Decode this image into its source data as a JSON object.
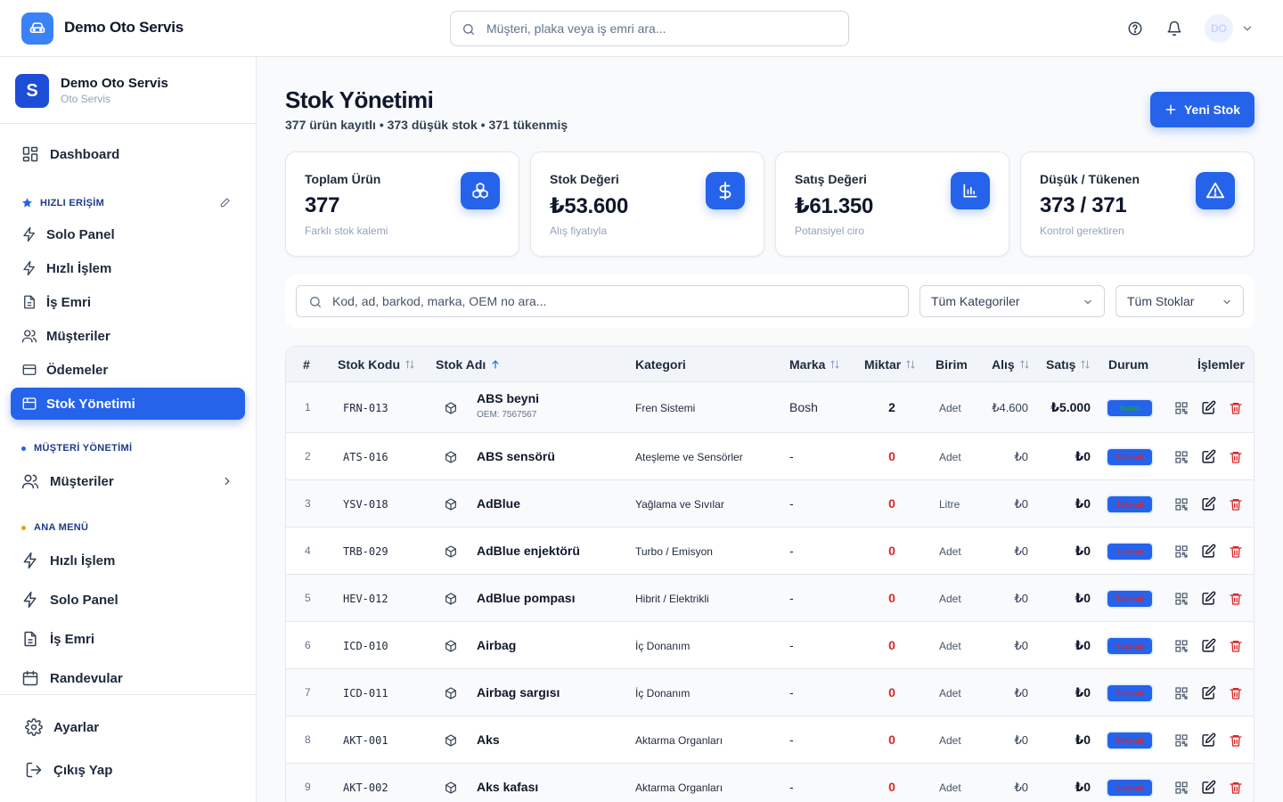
{
  "app": {
    "brand": "Demo Oto Servis",
    "search_placeholder": "Müşteri, plaka veya iş emri ara...",
    "avatar_initials": "DO"
  },
  "sidebar": {
    "org_initial": "S",
    "org_name": "Demo Oto Servis",
    "org_type": "Oto Servis",
    "dashboard": "Dashboard",
    "quick_access_title": "HIZLI ERİŞİM",
    "quick_items": [
      {
        "label": "Solo Panel",
        "icon": "bolt-icon"
      },
      {
        "label": "Hızlı İşlem",
        "icon": "bolt-icon"
      },
      {
        "label": "İş Emri",
        "icon": "document-icon"
      },
      {
        "label": "Müşteriler",
        "icon": "users-icon"
      },
      {
        "label": "Ödemeler",
        "icon": "credit-card-icon"
      },
      {
        "label": "Stok Yönetimi",
        "icon": "package-icon",
        "active": true
      }
    ],
    "customer_mgmt_title": "MÜŞTERİ YÖNETİMİ",
    "customer_mgmt_item": "Müşteriler",
    "main_menu_title": "ANA MENÜ",
    "main_items": [
      {
        "label": "Hızlı İşlem",
        "icon": "bolt-icon"
      },
      {
        "label": "Solo Panel",
        "icon": "bolt-icon"
      },
      {
        "label": "İş Emri",
        "icon": "document-icon"
      },
      {
        "label": "Randevular",
        "icon": "calendar-icon"
      }
    ],
    "settings": "Ayarlar",
    "logout": "Çıkış Yap",
    "colors": {
      "accent": "#2563eb",
      "quick_dot": "#2563eb",
      "mgmt_dot": "#2563eb",
      "main_dot": "#f59e0b"
    }
  },
  "page": {
    "title": "Stok Yönetimi",
    "subtitle": "377 ürün kayıtlı • 373 düşük stok • 371 tükenmiş",
    "new_button": "Yeni Stok"
  },
  "stats": [
    {
      "label": "Toplam Ürün",
      "value": "377",
      "hint": "Farklı stok kalemi",
      "icon": "cubes-icon"
    },
    {
      "label": "Stok Değeri",
      "value": "₺53.600",
      "hint": "Alış fiyatıyla",
      "icon": "dollar-icon"
    },
    {
      "label": "Satış Değeri",
      "value": "₺61.350",
      "hint": "Potansiyel ciro",
      "icon": "bar-chart-icon"
    },
    {
      "label": "Düşük / Tükenen",
      "value": "373 / 371",
      "hint": "Kontrol gerektiren",
      "icon": "warning-icon"
    }
  ],
  "filters": {
    "search_placeholder": "Kod, ad, barkod, marka, OEM no ara...",
    "category": "Tüm Kategoriler",
    "stock": "Tüm Stoklar"
  },
  "table": {
    "headers": {
      "num": "#",
      "code": "Stok Kodu",
      "name": "Stok Adı",
      "category": "Kategori",
      "brand": "Marka",
      "qty": "Miktar",
      "unit": "Birim",
      "buy": "Alış",
      "sell": "Satış",
      "status": "Durum",
      "actions": "İşlemler"
    },
    "rows": [
      {
        "num": "1",
        "code": "FRN-013",
        "name": "ABS beyni",
        "oem": "OEM: 7567567",
        "category": "Fren Sistemi",
        "brand": "Bosh",
        "qty": "2",
        "unit": "Adet",
        "buy": "₺4.600",
        "sell": "₺5.000",
        "status": "Yeterli",
        "status_type": "ok"
      },
      {
        "num": "2",
        "code": "ATS-016",
        "name": "ABS sensörü",
        "oem": "",
        "category": "Ateşleme ve Sensörler",
        "brand": "-",
        "qty": "0",
        "unit": "Adet",
        "buy": "₺0",
        "sell": "₺0",
        "status": "Tükendi",
        "status_type": "out"
      },
      {
        "num": "3",
        "code": "YSV-018",
        "name": "AdBlue",
        "oem": "",
        "category": "Yağlama ve Sıvılar",
        "brand": "-",
        "qty": "0",
        "unit": "Litre",
        "buy": "₺0",
        "sell": "₺0",
        "status": "Tükendi",
        "status_type": "out"
      },
      {
        "num": "4",
        "code": "TRB-029",
        "name": "AdBlue enjektörü",
        "oem": "",
        "category": "Turbo / Emisyon",
        "brand": "-",
        "qty": "0",
        "unit": "Adet",
        "buy": "₺0",
        "sell": "₺0",
        "status": "Tükendi",
        "status_type": "out"
      },
      {
        "num": "5",
        "code": "HEV-012",
        "name": "AdBlue pompası",
        "oem": "",
        "category": "Hibrit / Elektrikli",
        "brand": "-",
        "qty": "0",
        "unit": "Adet",
        "buy": "₺0",
        "sell": "₺0",
        "status": "Tükendi",
        "status_type": "out"
      },
      {
        "num": "6",
        "code": "ICD-010",
        "name": "Airbag",
        "oem": "",
        "category": "İç Donanım",
        "brand": "-",
        "qty": "0",
        "unit": "Adet",
        "buy": "₺0",
        "sell": "₺0",
        "status": "Tükendi",
        "status_type": "out"
      },
      {
        "num": "7",
        "code": "ICD-011",
        "name": "Airbag sargısı",
        "oem": "",
        "category": "İç Donanım",
        "brand": "-",
        "qty": "0",
        "unit": "Adet",
        "buy": "₺0",
        "sell": "₺0",
        "status": "Tükendi",
        "status_type": "out"
      },
      {
        "num": "8",
        "code": "AKT-001",
        "name": "Aks",
        "oem": "",
        "category": "Aktarma Organları",
        "brand": "-",
        "qty": "0",
        "unit": "Adet",
        "buy": "₺0",
        "sell": "₺0",
        "status": "Tükendi",
        "status_type": "out"
      },
      {
        "num": "9",
        "code": "AKT-002",
        "name": "Aks kafası",
        "oem": "",
        "category": "Aktarma Organları",
        "brand": "-",
        "qty": "0",
        "unit": "Adet",
        "buy": "₺0",
        "sell": "₺0",
        "status": "Tükendi",
        "status_type": "out"
      }
    ],
    "colors": {
      "qty_zero": "#dc2626",
      "qty_ok": "#0f172a",
      "delete": "#dc2626"
    }
  }
}
